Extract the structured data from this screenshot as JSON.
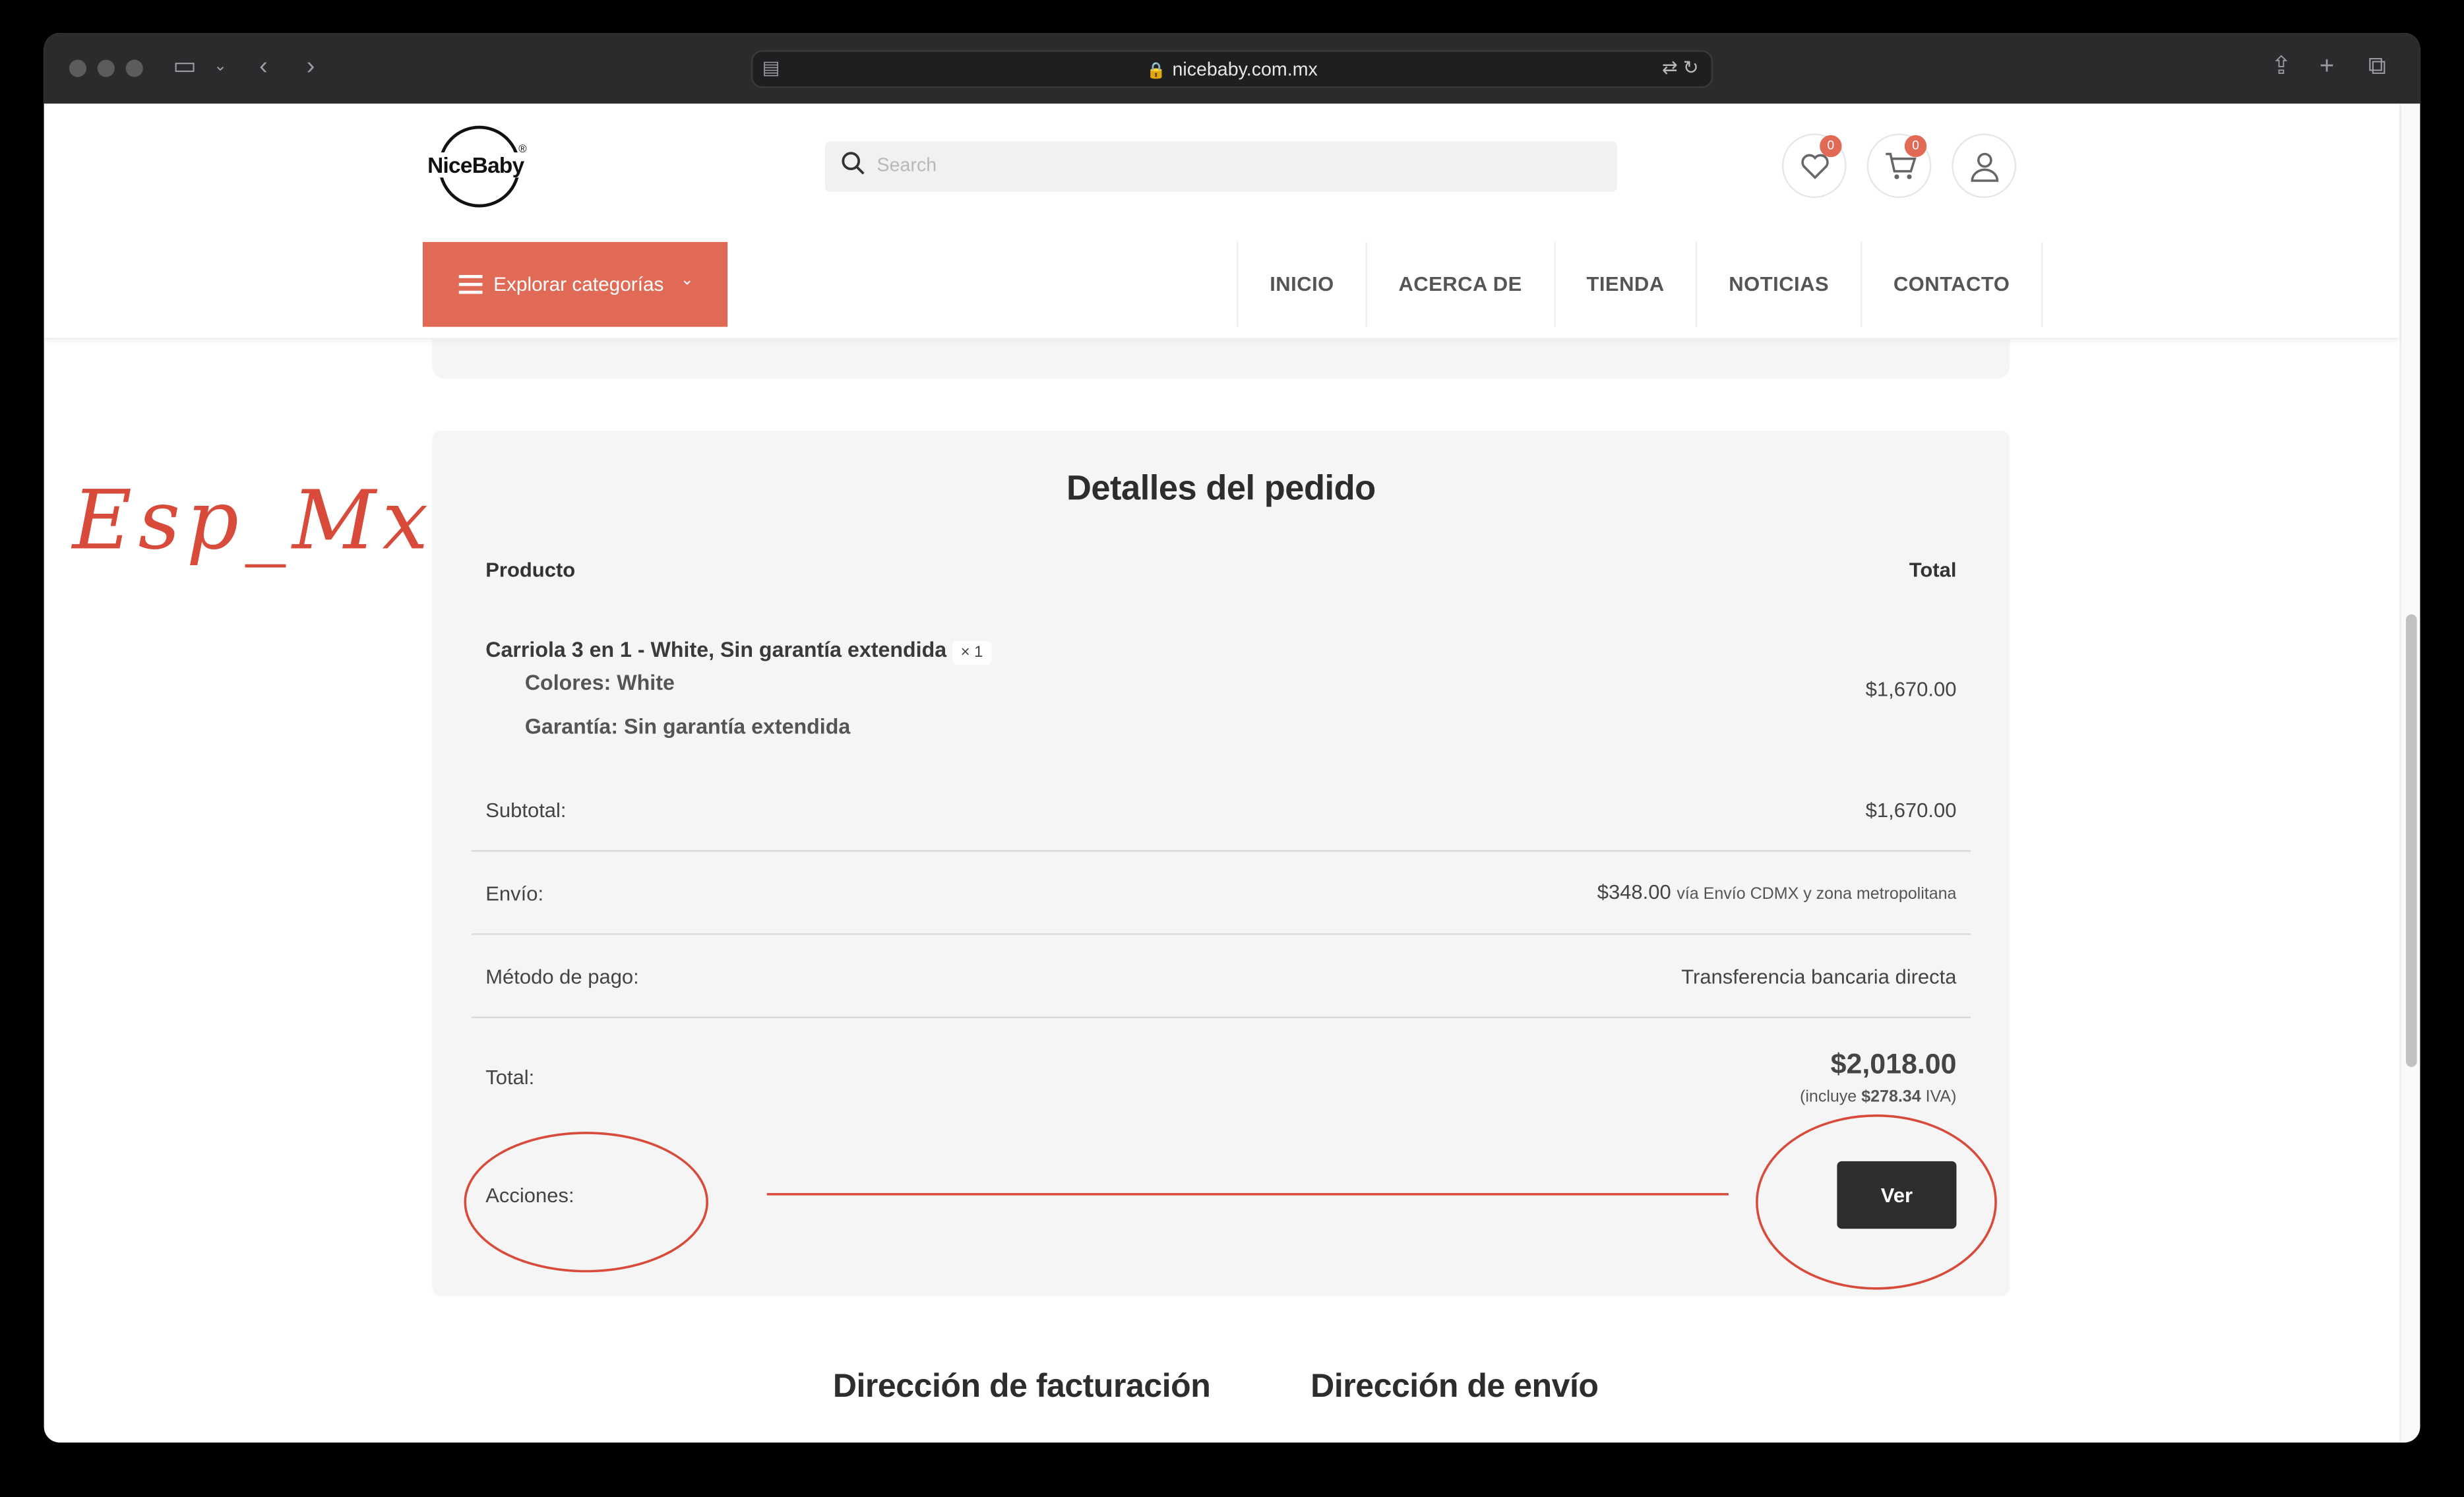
{
  "browser": {
    "url": "nicebaby.com.mx"
  },
  "header": {
    "logo_text": "NiceBaby",
    "logo_mark": "®",
    "search_placeholder": "Search",
    "wishlist_count": "0",
    "cart_count": "0",
    "categories_button": "Explorar categorías",
    "nav": [
      "INICIO",
      "ACERCA DE",
      "TIENDA",
      "NOTICIAS",
      "CONTACTO"
    ]
  },
  "order": {
    "title": "Detalles del pedido",
    "col_product": "Producto",
    "col_total": "Total",
    "product_name": "Carriola 3 en 1 - White, Sin garantía extendida",
    "product_qty": "× 1",
    "meta_color_label": "Colores:",
    "meta_color_value": "White",
    "meta_warranty_label": "Garantía:",
    "meta_warranty_value": "Sin garantía extendida",
    "product_total": "$1,670.00",
    "subtotal_label": "Subtotal:",
    "subtotal_value": "$1,670.00",
    "shipping_label": "Envío:",
    "shipping_value": "$348.00",
    "shipping_via": "vía Envío CDMX y zona metropolitana",
    "payment_label": "Método de pago:",
    "payment_value": "Transferencia bancaria directa",
    "total_label": "Total:",
    "total_value": "$2,018.00",
    "tax_prefix": "(incluye",
    "tax_amount": "$278.34",
    "tax_suffix": "IVA)",
    "actions_label": "Acciones:",
    "view_button": "Ver"
  },
  "addresses": {
    "billing_title": "Dirección de facturación",
    "shipping_title": "Dirección de envío"
  },
  "annotation": {
    "handwritten_note": "Esp_Mx",
    "color": "#d84a3a"
  },
  "colors": {
    "accent": "#e06a55",
    "dark_button": "#2e2e2e",
    "card_bg": "#f5f5f5"
  }
}
